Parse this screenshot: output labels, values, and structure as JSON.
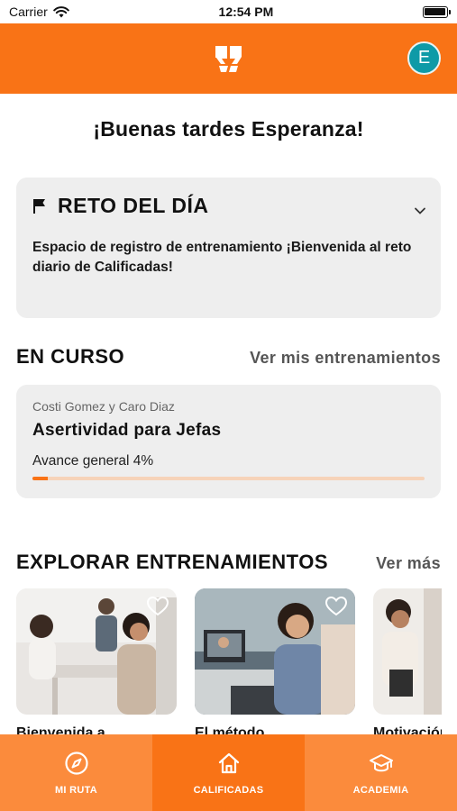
{
  "status_bar": {
    "carrier": "Carrier",
    "time": "12:54 PM"
  },
  "header": {
    "avatar_initial": "E"
  },
  "greeting": "¡Buenas tardes Esperanza!",
  "reto": {
    "title": "RETO DEL DÍA",
    "text": "Espacio de registro de entrenamiento ¡Bienvenida al reto diario de Calificadas!"
  },
  "en_curso": {
    "title": "EN CURSO",
    "link": "Ver mis entrenamientos",
    "course": {
      "authors": "Costi Gomez y Caro Diaz",
      "title": "Asertividad para Jefas",
      "progress_label": "Avance general 4%",
      "progress_percent": 4
    }
  },
  "explorar": {
    "title": "EXPLORAR ENTRENAMIENTOS",
    "link": "Ver más",
    "cards": [
      {
        "label": "Bienvenida a"
      },
      {
        "label": "El método"
      },
      {
        "label": "Motivación"
      }
    ]
  },
  "nav": {
    "items": [
      {
        "label": "MI RUTA",
        "icon": "compass-icon"
      },
      {
        "label": "CALIFICADAS",
        "icon": "home-icon"
      },
      {
        "label": "ACADEMIA",
        "icon": "graduation-cap-icon"
      }
    ],
    "active": 1
  },
  "colors": {
    "brand": "#f97316",
    "avatar": "#0e9aa7",
    "card_bg": "#eeeeee"
  }
}
